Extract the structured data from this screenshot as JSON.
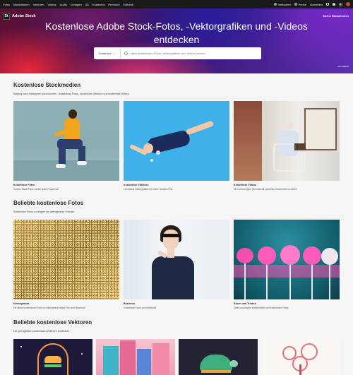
{
  "topnav": {
    "items": [
      "Fotos",
      "Illustrationen",
      "Vektoren",
      "Videos",
      "Audio",
      "Vorlagen",
      "3D",
      "Kostenlos",
      "Premium",
      "Editorial"
    ],
    "right": [
      "Verkaufen",
      "Preise",
      "Anmelden"
    ]
  },
  "hero": {
    "logo_mark": "St",
    "logo_name": "Adobe Stock",
    "my_libraries": "Meine Bibliotheken",
    "title": "Kostenlose Adobe Stock-Fotos, -Vektorgrafiken und -Videos entdecken",
    "search_category": "Kostenlos",
    "search_placeholder": "Nach kostenlosen Fotos, Vektorgrafiken und Videos suchen",
    "credit": "von Kalisdle"
  },
  "sections": {
    "stock": {
      "title": "Kostenlose Stockmedien",
      "subtitle": "Katalog nach Kategorien durchsuchen – kostenlose Fotos, kostenlose Vektoren und kostenlose Videos.",
      "cards": [
        {
          "title": "Kostenlose Fotos",
          "desc": "Schöne Stock-Fotos werten jedes Projekt auf"
        },
        {
          "title": "Kostenlose Vektoren",
          "desc": "Lizenzfreie Vektorgrafiken für mehr visuelles Flair"
        },
        {
          "title": "Kostenlose Videos",
          "desc": "Mit hochwertigem Filmmaterial packende Geschichten erzählen"
        }
      ]
    },
    "photos": {
      "title": "Beliebte kostenlose Fotos",
      "subtitle": "Kostenlose Fotos zu einigen der gefragtesten Themen",
      "cards": [
        {
          "title": "Hintergründe",
          "desc": "Mit diesen kostenlosen Fotos im Hintergrund bleiben Sie mehr Ausdruck"
        },
        {
          "title": "Business",
          "desc": "Kostenlose Fotos zur Arbeitswelt"
        },
        {
          "title": "Essen und Trinken",
          "desc": "Zarte und pikante Köstlichkeiten auf kostenlosen Fotos"
        }
      ]
    },
    "vectors": {
      "title": "Beliebte kostenlose Vektoren",
      "subtitle": "Die gefragtesten kostenlosen Vektoren entdecken"
    }
  }
}
